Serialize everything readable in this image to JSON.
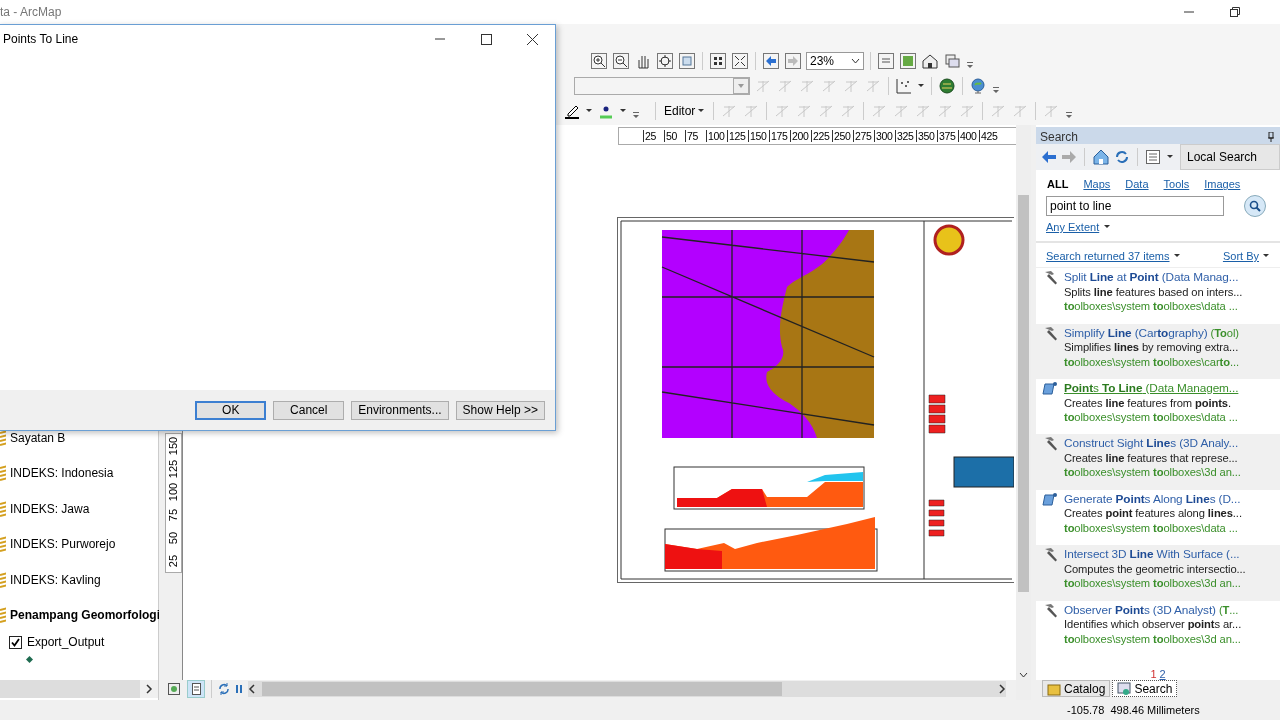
{
  "app": {
    "title": "ta - ArcMap"
  },
  "toolbar": {
    "zoom_level": "23%",
    "editor_menu": "Editor"
  },
  "rulers": {
    "horizontal": [
      "25",
      "50",
      "75",
      "100",
      "125",
      "150",
      "175",
      "200",
      "225",
      "250",
      "275",
      "300",
      "325",
      "350",
      "375",
      "400",
      "425"
    ],
    "vertical": [
      "150",
      "125",
      "100",
      "75",
      "50",
      "25"
    ]
  },
  "table_of_contents": {
    "items": [
      {
        "label": "Sayatan B",
        "active": false
      },
      {
        "label": "INDEKS: Indonesia",
        "active": false
      },
      {
        "label": "INDEKS: Jawa",
        "active": false
      },
      {
        "label": "INDEKS: Purworejo",
        "active": false
      },
      {
        "label": "INDEKS: Kavling",
        "active": false
      },
      {
        "label": "Penampang Geomorfologi",
        "active": true,
        "children": [
          {
            "label": "Export_Output",
            "checked": true
          }
        ]
      }
    ]
  },
  "dialog": {
    "title": "Points To Line",
    "buttons": [
      {
        "label": "OK",
        "focused": true
      },
      {
        "label": "Cancel",
        "focused": false
      },
      {
        "label": "Environments...",
        "focused": false
      },
      {
        "label": "Show Help >>",
        "focused": false
      }
    ]
  },
  "search_panel": {
    "title": "Search",
    "scope": "Local Search",
    "filters": [
      {
        "label": "ALL",
        "selected": true
      },
      {
        "label": "Maps",
        "selected": false
      },
      {
        "label": "Data",
        "selected": false
      },
      {
        "label": "Tools",
        "selected": false
      },
      {
        "label": "Images",
        "selected": false
      }
    ],
    "query": "point to line",
    "extent": "Any Extent",
    "summary": "Search returned 37 items",
    "sort": "Sort By",
    "results": [
      {
        "kind": "tool",
        "hovered": false,
        "title": "Split **Line** at **Point** (Data Manag...",
        "description": "Splits **line** features based on inters...",
        "path": "**to**olboxes\\system **to**olboxes\\data ..."
      },
      {
        "kind": "tool",
        "hovered": false,
        "title": "Simplify **Line** (Car**to**graphy)",
        "suffix": "(**To**ol)",
        "description": "Simplifies **lines** by removing extra...",
        "path": "**to**olboxes\\system **to**olboxes\\car**to**..."
      },
      {
        "kind": "script",
        "hovered": true,
        "title": "**Point**s **To Line** (Data Managem...",
        "description": "Creates **line** features from **points**.",
        "path": "**to**olboxes\\system **to**olboxes\\data ..."
      },
      {
        "kind": "tool",
        "hovered": false,
        "title": "Construct Sight **Line**s (3D Analy...",
        "description": "Creates **line** features that represe...",
        "path": "**to**olboxes\\system **to**olboxes\\3d an..."
      },
      {
        "kind": "script",
        "hovered": false,
        "title": "Generate **Point**s Along **Line**s (D...",
        "description": "Creates **point** features along **lines**...",
        "path": "**to**olboxes\\system **to**olboxes\\data ..."
      },
      {
        "kind": "tool",
        "hovered": false,
        "title": "Intersect 3D **Line** With Surface (...",
        "description": "Computes the geometric intersectio...",
        "path": "**to**olboxes\\system **to**olboxes\\3d an..."
      },
      {
        "kind": "tool",
        "hovered": false,
        "title": "Observer **Point**s (3D Analyst)",
        "suffix": "(**T**...",
        "description": "Identifies which observer **point**s ar...",
        "path": "**to**olboxes\\system **to**olboxes\\3d an..."
      }
    ],
    "pages": [
      {
        "label": "1",
        "selected": true
      },
      {
        "label": "2",
        "selected": false
      }
    ]
  },
  "dock_tabs": [
    {
      "label": "Catalog",
      "selected": false
    },
    {
      "label": "Search",
      "selected": true
    }
  ],
  "status_bar": {
    "coordinates": "-105.78  498.46 Millimeters"
  }
}
